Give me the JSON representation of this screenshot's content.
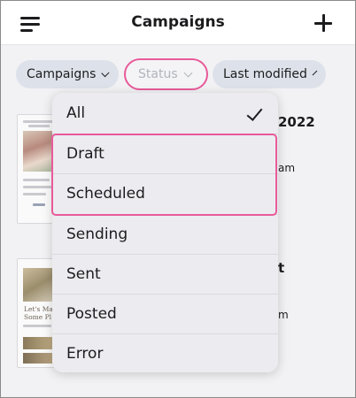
{
  "header": {
    "title": "Campaigns",
    "menu_icon": "hamburger-menu-icon",
    "add_icon": "plus-icon"
  },
  "filters": {
    "campaigns_label": "Campaigns",
    "status_label": "Status",
    "modified_label": "Last modified"
  },
  "background_list": {
    "item1_title_fragment": "2022",
    "item1_sub_fragment": "am",
    "item2_title_fragment": "t",
    "item2_sub_fragment": "m",
    "thumb2_script_line1": "Let's Ma",
    "thumb2_script_line2": "Some Pl"
  },
  "status_dropdown": {
    "options": [
      {
        "label": "All",
        "selected": true
      },
      {
        "label": "Draft",
        "selected": false
      },
      {
        "label": "Scheduled",
        "selected": false
      },
      {
        "label": "Sending",
        "selected": false
      },
      {
        "label": "Sent",
        "selected": false
      },
      {
        "label": "Posted",
        "selected": false
      },
      {
        "label": "Error",
        "selected": false
      }
    ]
  },
  "colors": {
    "highlight": "#e85a9a",
    "chip_bg": "#dde2ea",
    "dropdown_bg": "#ececf0",
    "page_bg": "#f2f2f4"
  }
}
